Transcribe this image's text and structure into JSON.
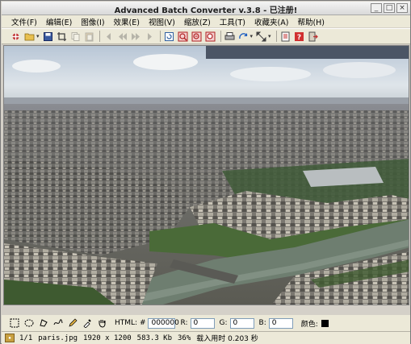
{
  "window": {
    "title": "Advanced Batch Converter v.3.8 - 已注册!"
  },
  "menu": [
    "文件(F)",
    "编辑(E)",
    "图像(I)",
    "效果(E)",
    "视图(V)",
    "缩放(Z)",
    "工具(T)",
    "收藏夹(A)",
    "帮助(H)"
  ],
  "toolbar_icons": [
    "convert-icon",
    "open-folder-icon",
    "save-icon",
    "crop-icon",
    "copy-icon",
    "paste-icon",
    "back-icon",
    "prev-icon",
    "next-icon",
    "forward-icon",
    "refresh-icon",
    "zoom-in-icon",
    "zoom-out-icon",
    "zoom-fit-icon",
    "print-icon",
    "rotate-icon",
    "resize-icon",
    "info-icon",
    "help-icon",
    "exit-icon"
  ],
  "tools": {
    "html_label": "HTML: #",
    "html_value": "000000",
    "r_label": "R:",
    "r_value": "0",
    "g_label": "G:",
    "g_value": "0",
    "b_label": "B:",
    "b_value": "0",
    "color_label": "颜色:",
    "color_swatch": "#000000"
  },
  "status": {
    "index": "1/1",
    "filename": "paris.jpg",
    "dimensions": "1920 x 1200",
    "filesize": "583.3 Kb",
    "zoom": "36%",
    "load_time": "载入用时 0.203 秒"
  }
}
